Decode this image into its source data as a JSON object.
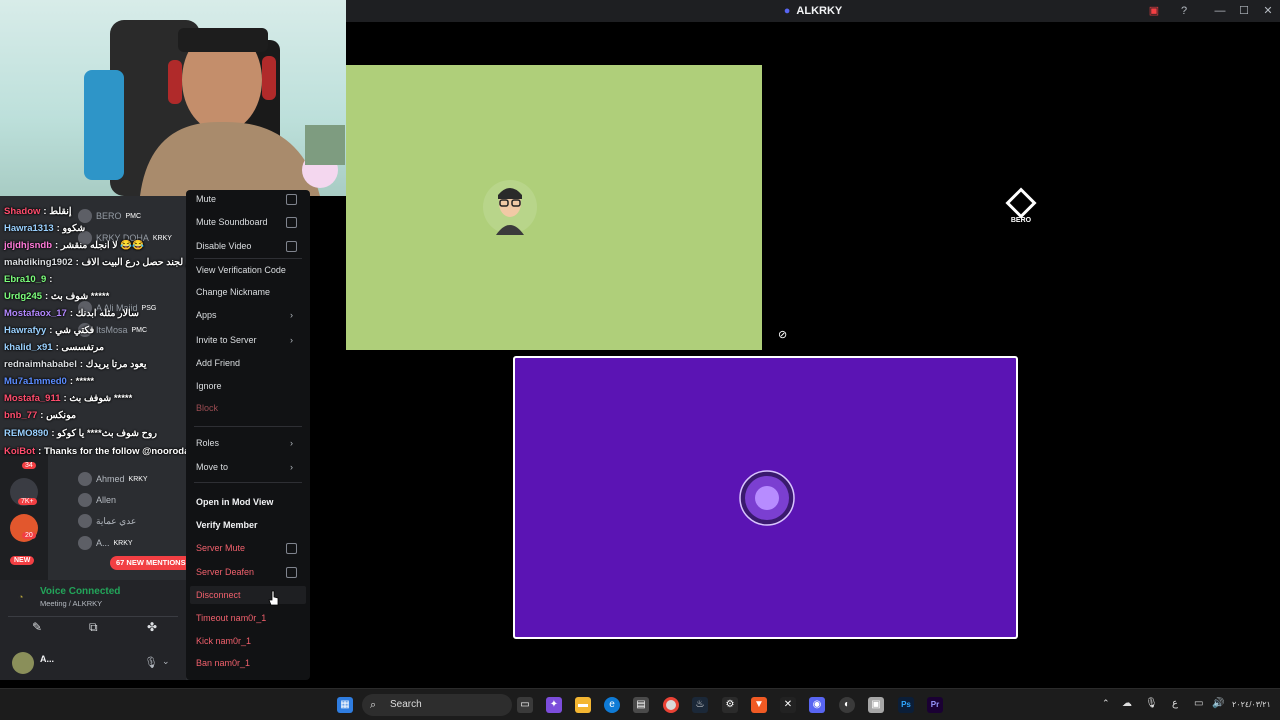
{
  "window": {
    "title": "ALKRKY",
    "minimize": "—",
    "maximize": "☐",
    "close": "✕"
  },
  "stage": {
    "green_tile_user": "",
    "purple_tile_user": "",
    "bero_label": "BERO"
  },
  "chat": [
    {
      "user": "Shadow",
      "msg": ": إنقلط",
      "color": "#ff4d6d"
    },
    {
      "user": "Hawra1313",
      "msg": ": شكوو",
      "color": "#9ad1ff"
    },
    {
      "user": "jdjdhjsndb",
      "msg": ": لا انجله منقشر 😂😂",
      "color": "#ff7ad9"
    },
    {
      "user": "mahdiking1902",
      "msg": ": سلار ثيم لجند حصل درع البيت الاف",
      "color": "#dbdee1"
    },
    {
      "user": "Ebra10_9",
      "msg": ":",
      "color": "#7cff7c"
    },
    {
      "user": "Urdg245",
      "msg": ": شوف بث *****",
      "color": "#7cff7c"
    },
    {
      "user": "Mostafaox_17",
      "msg": ": سالار مثله ابدنك",
      "color": "#b388ff"
    },
    {
      "user": "Hawrafyy",
      "msg": ": فكتي شي",
      "color": "#9ad1ff"
    },
    {
      "user": "khalid_x91",
      "msg": ": مرتفسسى",
      "color": "#9ad1ff"
    },
    {
      "user": "rednaimhababel",
      "msg": ": يعود مرتا يريدك",
      "color": "#dbdee1"
    },
    {
      "user": "Mu7a1mmed0",
      "msg": ": *****",
      "color": "#5b8cff"
    },
    {
      "user": "Mostafa_911",
      "msg": ": شوفف بث *****",
      "color": "#ff4d6d"
    },
    {
      "user": "bnb_77",
      "msg": ": مونكس",
      "color": "#ff4d6d"
    },
    {
      "user": "REMO890",
      "msg": ": روح شوف بث**** يا كوكو",
      "color": "#9ad1ff"
    },
    {
      "user": "KoiBot",
      "msg": ": Thanks for the follow @noorodas",
      "color": "#ff4d6d"
    }
  ],
  "members": [
    {
      "name": "BERO",
      "badge": "PMC"
    },
    {
      "name": "KRKY DOHA",
      "badge": "KRKY"
    },
    {
      "name": "A Ali Majid",
      "badge": "PSG"
    },
    {
      "name": "ItsMosa",
      "badge": "PMC"
    },
    {
      "name": "Ahmed",
      "badge": "KRKY"
    },
    {
      "name": "Allen",
      "badge": ""
    },
    {
      "name": "عدي عماية",
      "badge": ""
    },
    {
      "name": "A...",
      "badge": "KRKY"
    }
  ],
  "guild_badges": [
    "34",
    "7K+",
    "20",
    "NEW"
  ],
  "new_mentions": "67 NEW MENTIONS",
  "context_menu": {
    "items": [
      {
        "label": "Mute",
        "style": "normal",
        "check": true
      },
      {
        "label": "Mute Soundboard",
        "style": "normal",
        "check": true
      },
      {
        "label": "Disable Video",
        "style": "normal",
        "check": true
      },
      {
        "label": "View Verification Code",
        "style": "normal"
      },
      {
        "label": "Change Nickname",
        "style": "normal"
      },
      {
        "label": "Apps",
        "style": "normal",
        "arrow": true
      },
      {
        "label": "Invite to Server",
        "style": "normal",
        "arrow": true
      },
      {
        "label": "Add Friend",
        "style": "normal"
      },
      {
        "label": "Ignore",
        "style": "normal"
      },
      {
        "label": "Block",
        "style": "dim"
      },
      {
        "label": "Roles",
        "style": "normal",
        "arrow": true
      },
      {
        "label": "Move to",
        "style": "normal",
        "arrow": true
      },
      {
        "label": "Open in Mod View",
        "style": "bold"
      },
      {
        "label": "Verify Member",
        "style": "bold"
      },
      {
        "label": "Server Mute",
        "style": "red",
        "check": true
      },
      {
        "label": "Server Deafen",
        "style": "red",
        "check": true
      },
      {
        "label": "Disconnect",
        "style": "red"
      },
      {
        "label": "Timeout nam0r_1",
        "style": "red"
      },
      {
        "label": "Kick nam0r_1",
        "style": "red"
      },
      {
        "label": "Ban nam0r_1",
        "style": "red"
      }
    ]
  },
  "voice": {
    "status": "Voice Connected",
    "channel": "Meeting / ALKRKY",
    "user": "A..."
  },
  "taskbar": {
    "search": "Search",
    "date": "٢٠٢٤/٠٣/٢١"
  },
  "colors": {
    "discord_blurple": "#5865f2",
    "green_tile": "#afcf7a",
    "purple_tile": "#5b14b4",
    "danger": "#f0606c"
  }
}
